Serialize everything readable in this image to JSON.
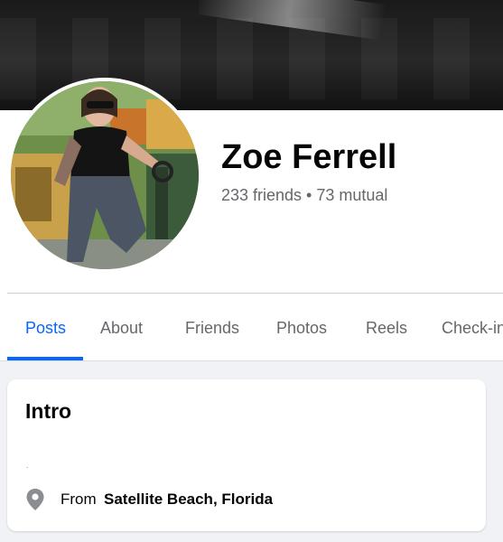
{
  "profile": {
    "name": "Zoe Ferrell",
    "friends_summary": "233 friends • 73 mutual",
    "avatar_icon": "profile-photo"
  },
  "tabs": [
    {
      "label": "Posts",
      "active": true
    },
    {
      "label": "About",
      "active": false
    },
    {
      "label": "Friends",
      "active": false
    },
    {
      "label": "Photos",
      "active": false
    },
    {
      "label": "Reels",
      "active": false
    },
    {
      "label": "Check-ins",
      "active": false
    }
  ],
  "intro": {
    "title": "Intro",
    "bio": ".",
    "location_prefix": "From",
    "location_value": "Satellite Beach, Florida",
    "location_icon": "map-pin-icon"
  },
  "colors": {
    "accent": "#0866ff",
    "text_primary": "#050505",
    "text_secondary": "#65676b",
    "page_background": "#f0f2f5"
  }
}
